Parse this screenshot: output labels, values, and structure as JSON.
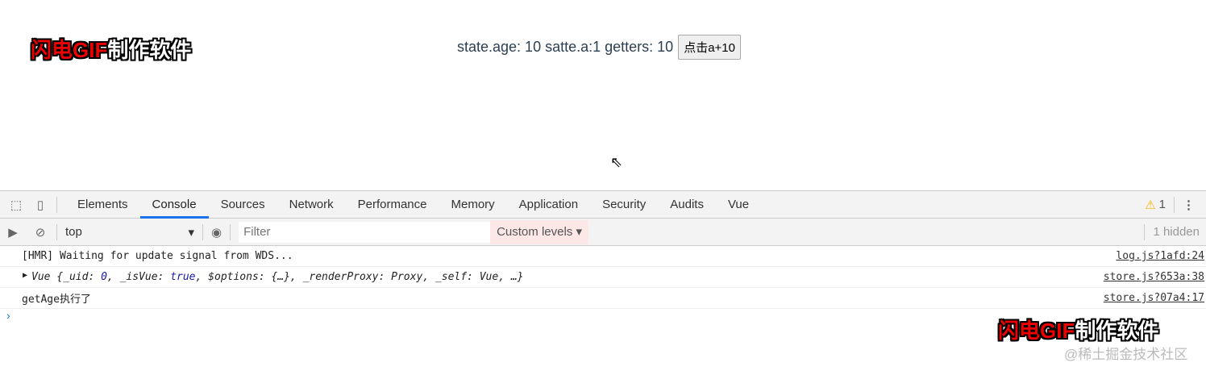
{
  "watermark": {
    "red": "闪电GIF",
    "white": "制作软件"
  },
  "app": {
    "text": "state.age: 10 satte.a:1 getters: 10",
    "button": "点击a+10"
  },
  "devtools": {
    "tabs": [
      "Elements",
      "Console",
      "Sources",
      "Network",
      "Performance",
      "Memory",
      "Application",
      "Security",
      "Audits",
      "Vue"
    ],
    "warning_count": "1",
    "context": "top",
    "filter_placeholder": "Filter",
    "levels": "Custom levels ▾",
    "hidden": "1 hidden",
    "logs": [
      {
        "text": "[HMR] Waiting for update signal from WDS...",
        "source": "log.js?1afd:24"
      },
      {
        "prefix": "Vue {_uid: ",
        "uid": "0",
        "mid": ", _isVue: ",
        "isvue": "true",
        "rest": ", $options: {…}, _renderProxy: Proxy, _self: Vue, …}",
        "source": "store.js?653a:38"
      },
      {
        "text": "getAge执行了",
        "source": "store.js?07a4:17"
      }
    ]
  },
  "credit": "@稀土掘金技术社区"
}
